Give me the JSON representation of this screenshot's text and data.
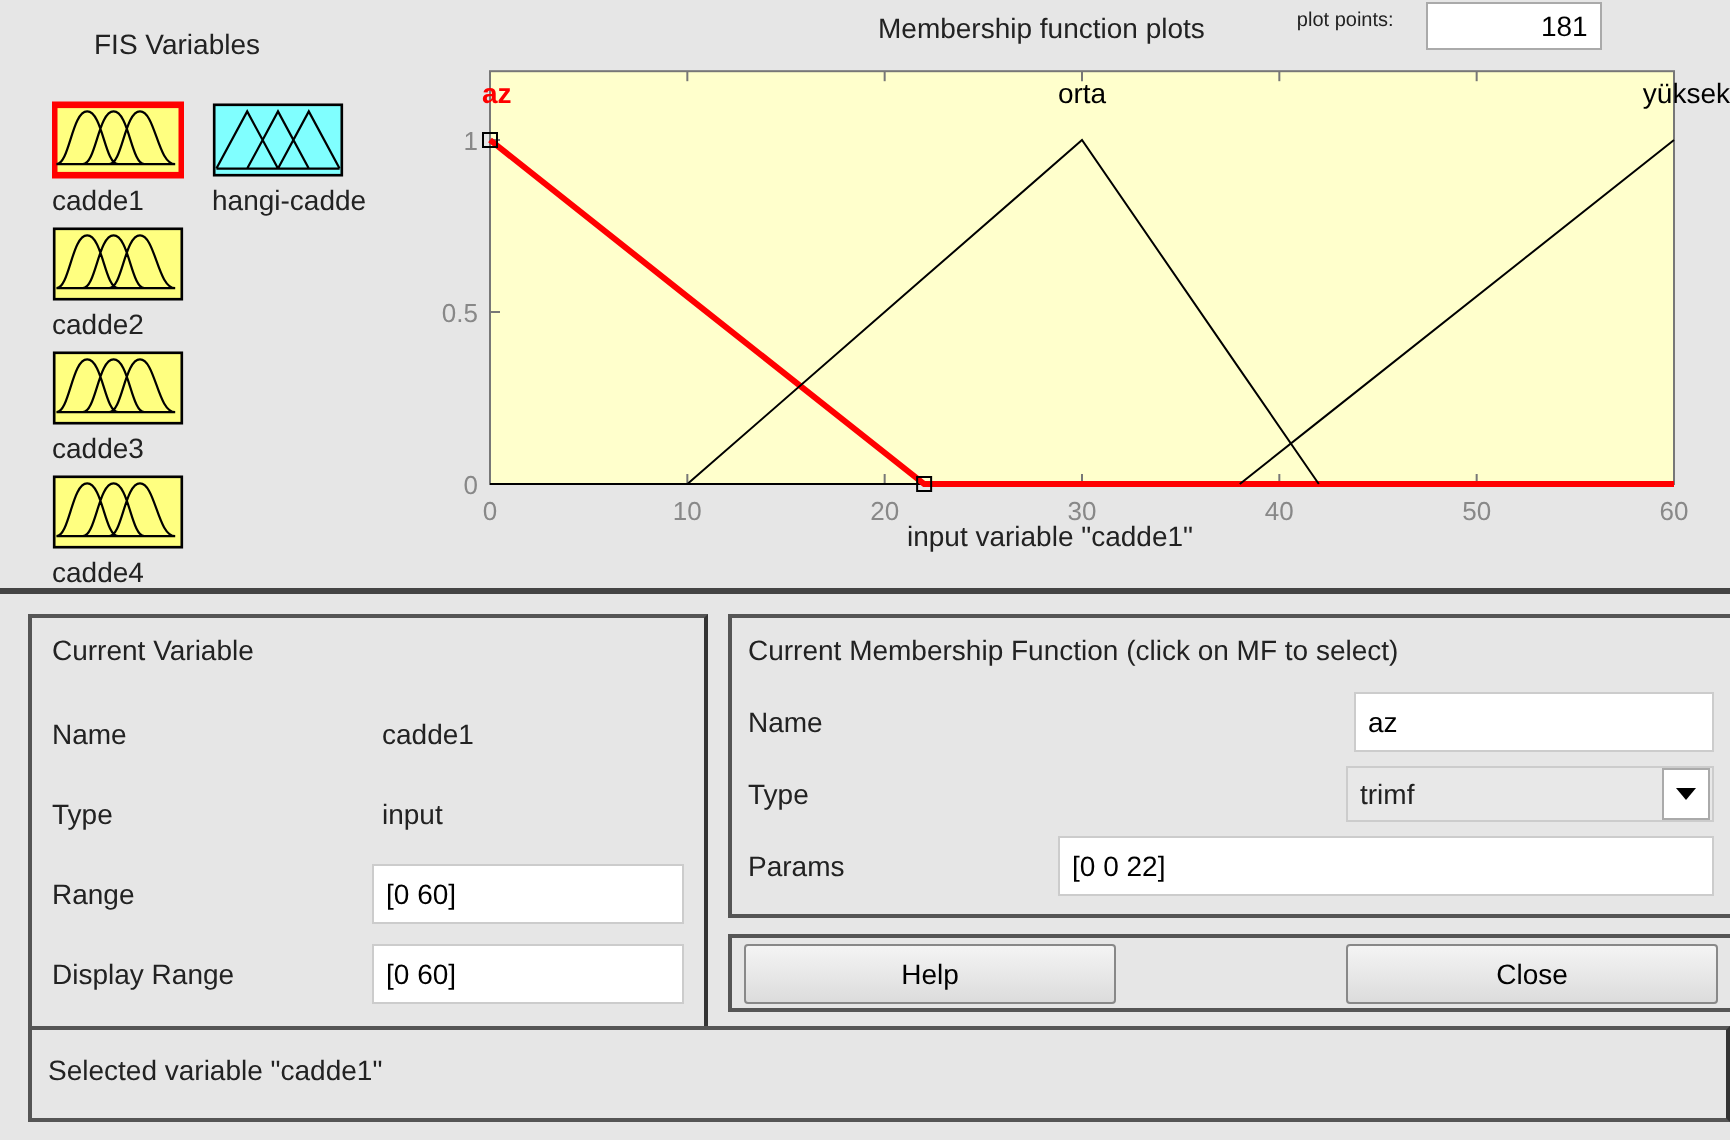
{
  "fis_variables": {
    "title": "FIS Variables",
    "items": [
      {
        "name": "cadde1",
        "kind": "input",
        "selected": true
      },
      {
        "name": "hangi-cadde",
        "kind": "output",
        "selected": false
      },
      {
        "name": "cadde2",
        "kind": "input",
        "selected": false
      },
      {
        "name": "cadde3",
        "kind": "input",
        "selected": false
      },
      {
        "name": "cadde4",
        "kind": "input",
        "selected": false
      }
    ]
  },
  "plot": {
    "title": "Membership function plots",
    "plot_points_label": "plot points:",
    "plot_points": "181",
    "chart_data": {
      "type": "line",
      "xlabel": "input variable \"cadde1\"",
      "x": [
        0,
        10,
        22,
        30,
        38,
        42,
        60
      ],
      "series": [
        {
          "name": "az",
          "color": "#ff0000",
          "values": [
            1,
            0.545,
            0,
            0,
            0,
            0,
            0
          ]
        },
        {
          "name": "orta",
          "color": "#000000",
          "values": [
            null,
            0,
            0.6,
            1,
            0.333,
            0,
            null
          ]
        },
        {
          "name": "yüksek",
          "color": "#000000",
          "values": [
            null,
            null,
            null,
            null,
            0,
            0.182,
            1
          ]
        }
      ],
      "xlim": [
        0,
        60
      ],
      "ylim": [
        0,
        1.2
      ],
      "xticks": [
        0,
        10,
        20,
        30,
        40,
        50,
        60
      ],
      "yticks": [
        0,
        0.5,
        1
      ]
    },
    "curve_states": [
      {
        "selected": true
      },
      {
        "selected": false
      },
      {
        "selected": false
      }
    ]
  },
  "current_variable": {
    "title": "Current Variable",
    "fields": [
      {
        "label": "Name",
        "value": "cadde1",
        "kind": "text"
      },
      {
        "label": "Type",
        "value": "input",
        "kind": "text"
      },
      {
        "label": "Range",
        "value": "[0 60]",
        "kind": "input"
      },
      {
        "label": "Display Range",
        "value": "[0 60]",
        "kind": "input"
      }
    ]
  },
  "current_mf": {
    "title": "Current Membership Function (click on MF to select)",
    "fields": [
      {
        "label": "Name",
        "value": "az",
        "kind": "input"
      },
      {
        "label": "Type",
        "value": "trimf",
        "kind": "dropdown"
      },
      {
        "label": "Params",
        "value": "[0 0 22]",
        "kind": "wide"
      }
    ]
  },
  "buttons": [
    "Help",
    "Close"
  ],
  "status_bar": "Selected variable \"cadde1\""
}
